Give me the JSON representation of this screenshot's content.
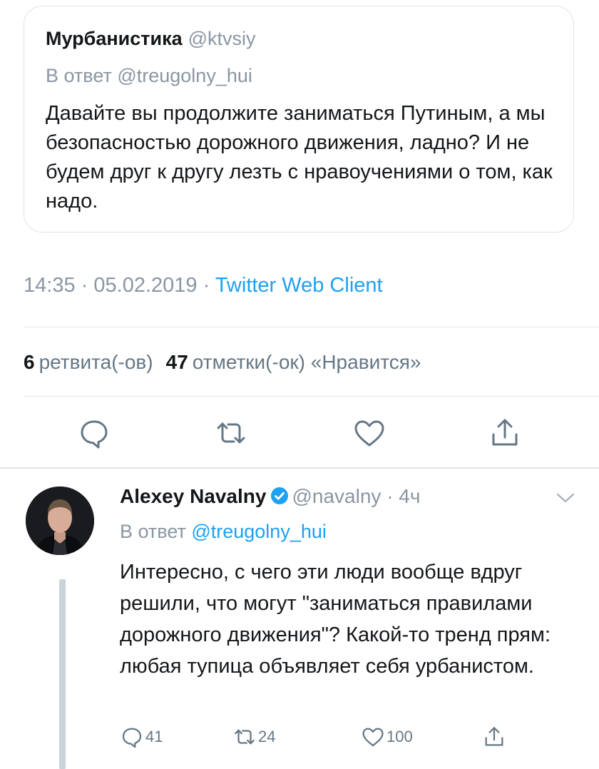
{
  "quoted_tweet": {
    "display_name": "Мурбанистика",
    "handle": "@ktvsiy",
    "reply_prefix": "В ответ",
    "reply_to": "@treugolny_hui",
    "text": "Давайте вы продолжите заниматься Путиным, а мы безопасностью дорожного движения, ладно? И не будем друг к другу лезть с нравоучениями о том, как надо."
  },
  "meta": {
    "time": "14:35",
    "separator": "·",
    "date": "05.02.2019",
    "client": "Twitter Web Client"
  },
  "stats": {
    "retweets_count": "6",
    "retweets_label": "ретвита(-ов)",
    "likes_count": "47",
    "likes_label": "отметки(-ок) «Нравится»"
  },
  "actions": [
    "reply-icon",
    "retweet-icon",
    "like-icon",
    "share-icon"
  ],
  "reply_tweet": {
    "display_name": "Alexey Navalny",
    "handle": "@navalny",
    "separator": "·",
    "time_ago": "4ч",
    "reply_prefix": "В ответ",
    "reply_to": "@treugolny_hui",
    "text": "Интересно, с чего эти люди вообще вдруг решили, что могут \"заниматься правилами дорожного движения\"? Какой-то тренд прям: любая тупица объявляет себя урбанистом.",
    "counts": {
      "replies": "41",
      "retweets": "24",
      "likes": "100"
    }
  },
  "colors": {
    "accent": "#1da1f2",
    "muted": "#8a96a3",
    "text": "#14171a",
    "divider": "#e1e6ea"
  }
}
